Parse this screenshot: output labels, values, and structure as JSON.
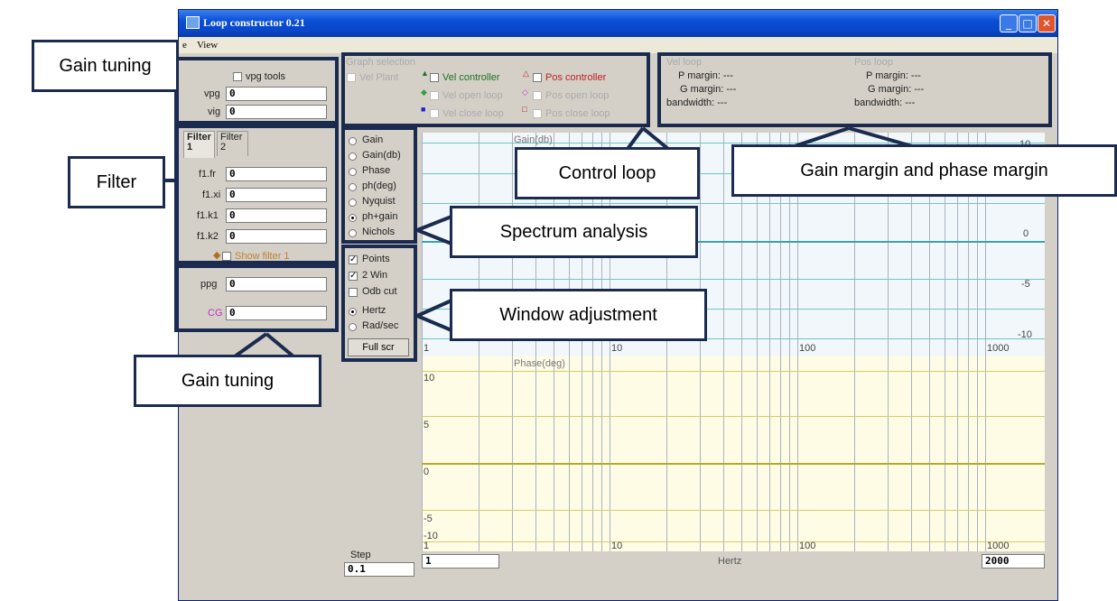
{
  "window": {
    "title": "Loop constructor 0.21",
    "min": "_",
    "max": "□",
    "close": "✕"
  },
  "menu": {
    "file": "e",
    "view": "View"
  },
  "gain_tuning": {
    "vpg_tools": "vpg tools",
    "vpg_label": "vpg",
    "vpg_value": "0",
    "vig_label": "vig",
    "vig_value": "0"
  },
  "filter": {
    "tab1": "Filter 1",
    "tab2": "Filter 2",
    "fields": [
      {
        "label": "f1.fr",
        "value": "0"
      },
      {
        "label": "f1.xi",
        "value": "0"
      },
      {
        "label": "f1.k1",
        "value": "0"
      },
      {
        "label": "f1.k2",
        "value": "0"
      }
    ],
    "show": "Show filter 1"
  },
  "gain2": {
    "ppg_label": "ppg",
    "ppg_value": "0",
    "cg_label": "CG",
    "cg_value": "0"
  },
  "graph_selection": {
    "title": "Graph selection",
    "vel_plant": "Vel Plant",
    "vel_controller": "Vel controller",
    "vel_open": "Vel open loop",
    "vel_close": "Vel close loop",
    "pos_controller": "Pos controller",
    "pos_open": "Pos open loop",
    "pos_close": "Pos close loop"
  },
  "vel_loop": {
    "title": "Vel loop",
    "p_margin": "P margin: ---",
    "g_margin": "G margin: ---",
    "bandwidth": "bandwidth: ---"
  },
  "pos_loop": {
    "title": "Pos loop",
    "p_margin": "P margin: ---",
    "g_margin": "G margin: ---",
    "bandwidth": "bandwidth: ---"
  },
  "spectrum": [
    "Gain",
    "Gain(db)",
    "Phase",
    "ph(deg)",
    "Nyquist",
    "ph+gain",
    "Nichols"
  ],
  "window_adj": {
    "points": "Points",
    "two_win": "2 Win",
    "odb_cut": "Odb cut",
    "hertz": "Hertz",
    "radsec": "Rad/sec",
    "full_scr": "Full scr"
  },
  "step": {
    "label": "Step",
    "value": "0.1"
  },
  "gain_plot": {
    "title": "Gain(db)",
    "y_ticks": [
      "10",
      "0",
      "-5",
      "-10"
    ],
    "x_ticks": [
      "1",
      "10",
      "100",
      "1000"
    ]
  },
  "phase_plot": {
    "title": "Phase(deg)",
    "y_ticks": [
      "10",
      "5",
      "0",
      "-5",
      "-10"
    ],
    "x_ticks": [
      "1",
      "10",
      "100",
      "1000"
    ]
  },
  "bottom": {
    "min_freq": "1",
    "unit": "Hertz",
    "max_freq": "2000"
  },
  "annotations": {
    "gain_tuning_top": "Gain tuning",
    "filter": "Filter",
    "gain_tuning_bottom": "Gain tuning",
    "control_loop": "Control loop",
    "gain_margin": "Gain margin and phase margin",
    "spectrum_analysis": "Spectrum analysis",
    "window_adjustment": "Window adjustment"
  }
}
